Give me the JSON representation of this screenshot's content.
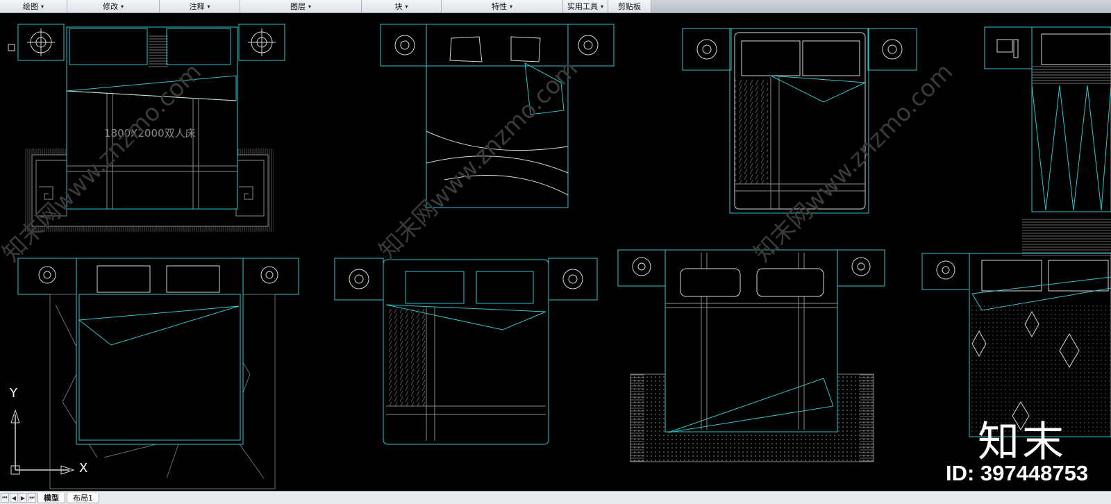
{
  "ribbon": {
    "tabs": [
      {
        "label": "绘图",
        "arrow": "▾"
      },
      {
        "label": "修改",
        "arrow": "▾"
      },
      {
        "label": "注释",
        "arrow": "▾"
      },
      {
        "label": "图层",
        "arrow": "▾"
      },
      {
        "label": "块",
        "arrow": "▾"
      },
      {
        "label": "特性",
        "arrow": "▾"
      },
      {
        "label": "实用工具",
        "arrow": "▾"
      },
      {
        "label": "剪贴板",
        "arrow": ""
      }
    ]
  },
  "drawing": {
    "bed_label": "1800X2000双人床",
    "watermark_text": "知末网www.znzmo.com",
    "colors": {
      "cyan": "#2fc6cc",
      "white": "#d8d8d8",
      "gray": "#6e6e6e",
      "background": "#000000"
    }
  },
  "ucs": {
    "y_label": "Y",
    "x_label": "X"
  },
  "layout_tabs": {
    "model": "模型",
    "layout1": "布局1"
  },
  "brand": {
    "logo": "知末",
    "id": "ID: 397448753"
  }
}
